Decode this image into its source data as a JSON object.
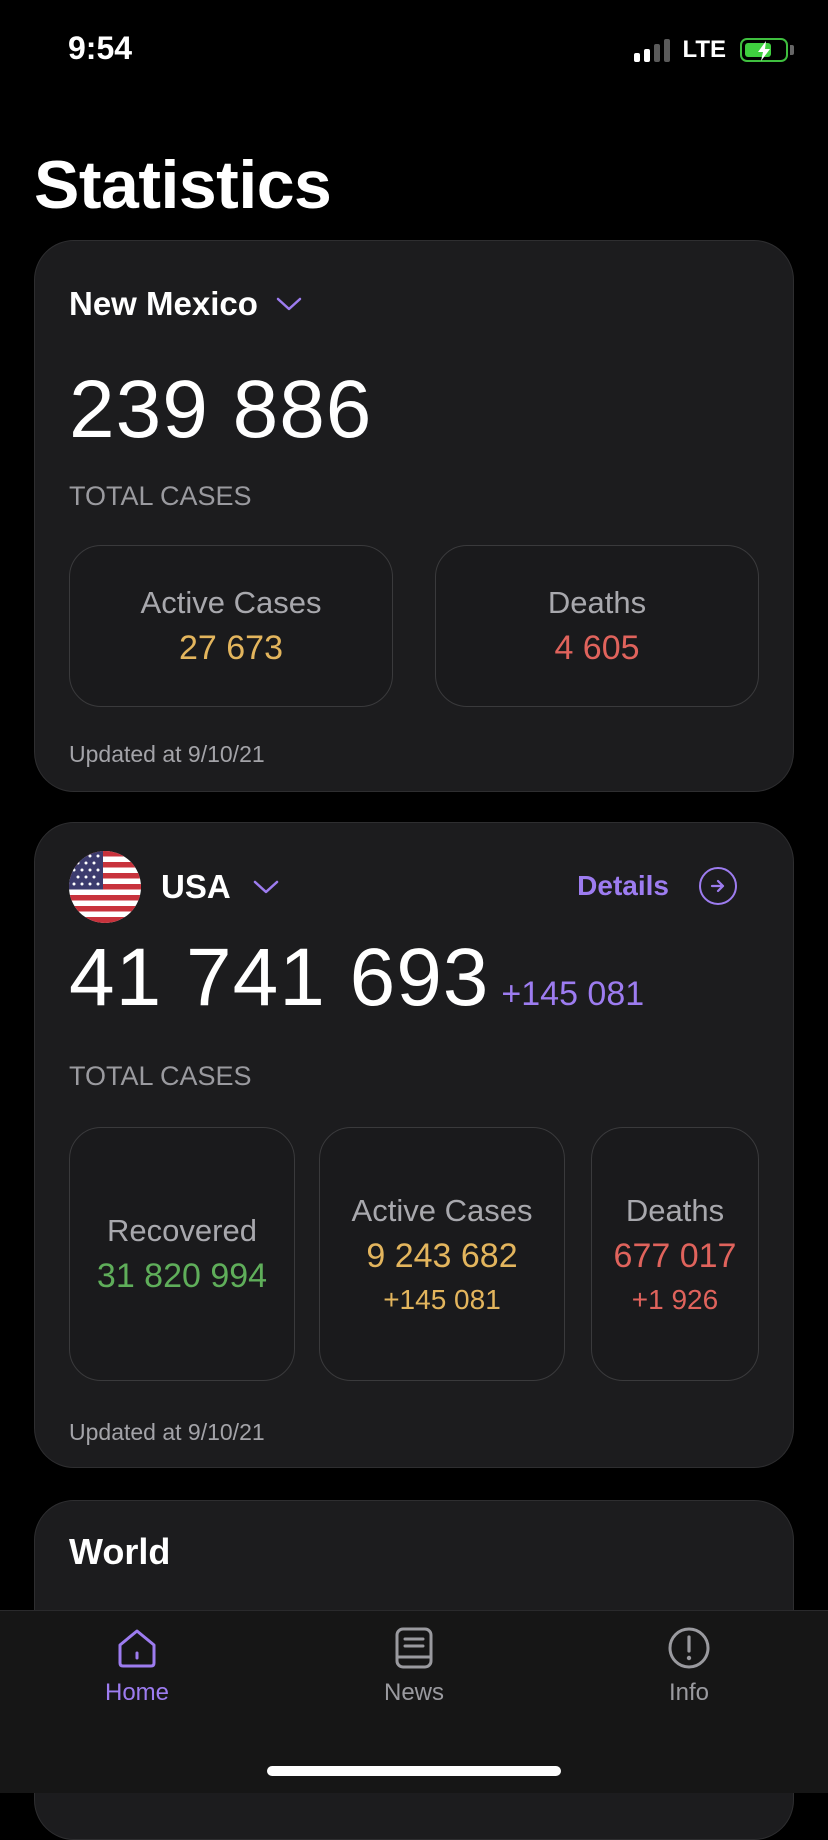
{
  "status_bar": {
    "time": "9:54",
    "network": "LTE"
  },
  "page_title": "Statistics",
  "regional": {
    "name": "New Mexico",
    "total_cases": "239 886",
    "total_label": "TOTAL CASES",
    "stats": [
      {
        "label": "Active Cases",
        "value": "27 673"
      },
      {
        "label": "Deaths",
        "value": "4 605"
      }
    ],
    "updated": "Updated at 9/10/21"
  },
  "country": {
    "name": "USA",
    "details_label": "Details",
    "total_cases": "41 741 693",
    "total_delta": "+145 081",
    "total_label": "TOTAL CASES",
    "stats": [
      {
        "label": "Recovered",
        "value": "31 820 994"
      },
      {
        "label": "Active Cases",
        "value": "9 243 682",
        "delta": "+145 081"
      },
      {
        "label": "Deaths",
        "value": "677 017",
        "delta": "+1 926"
      }
    ],
    "updated": "Updated at 9/10/21"
  },
  "world": {
    "title": "World"
  },
  "tabs": [
    {
      "label": "Home",
      "icon": "home-icon",
      "active": true
    },
    {
      "label": "News",
      "icon": "news-icon",
      "active": false
    },
    {
      "label": "Info",
      "icon": "info-icon",
      "active": false
    }
  ],
  "colors": {
    "accent": "#9d7cf0",
    "active": "#e3b55d",
    "deaths": "#e0635c",
    "recovered": "#5fae5a"
  }
}
